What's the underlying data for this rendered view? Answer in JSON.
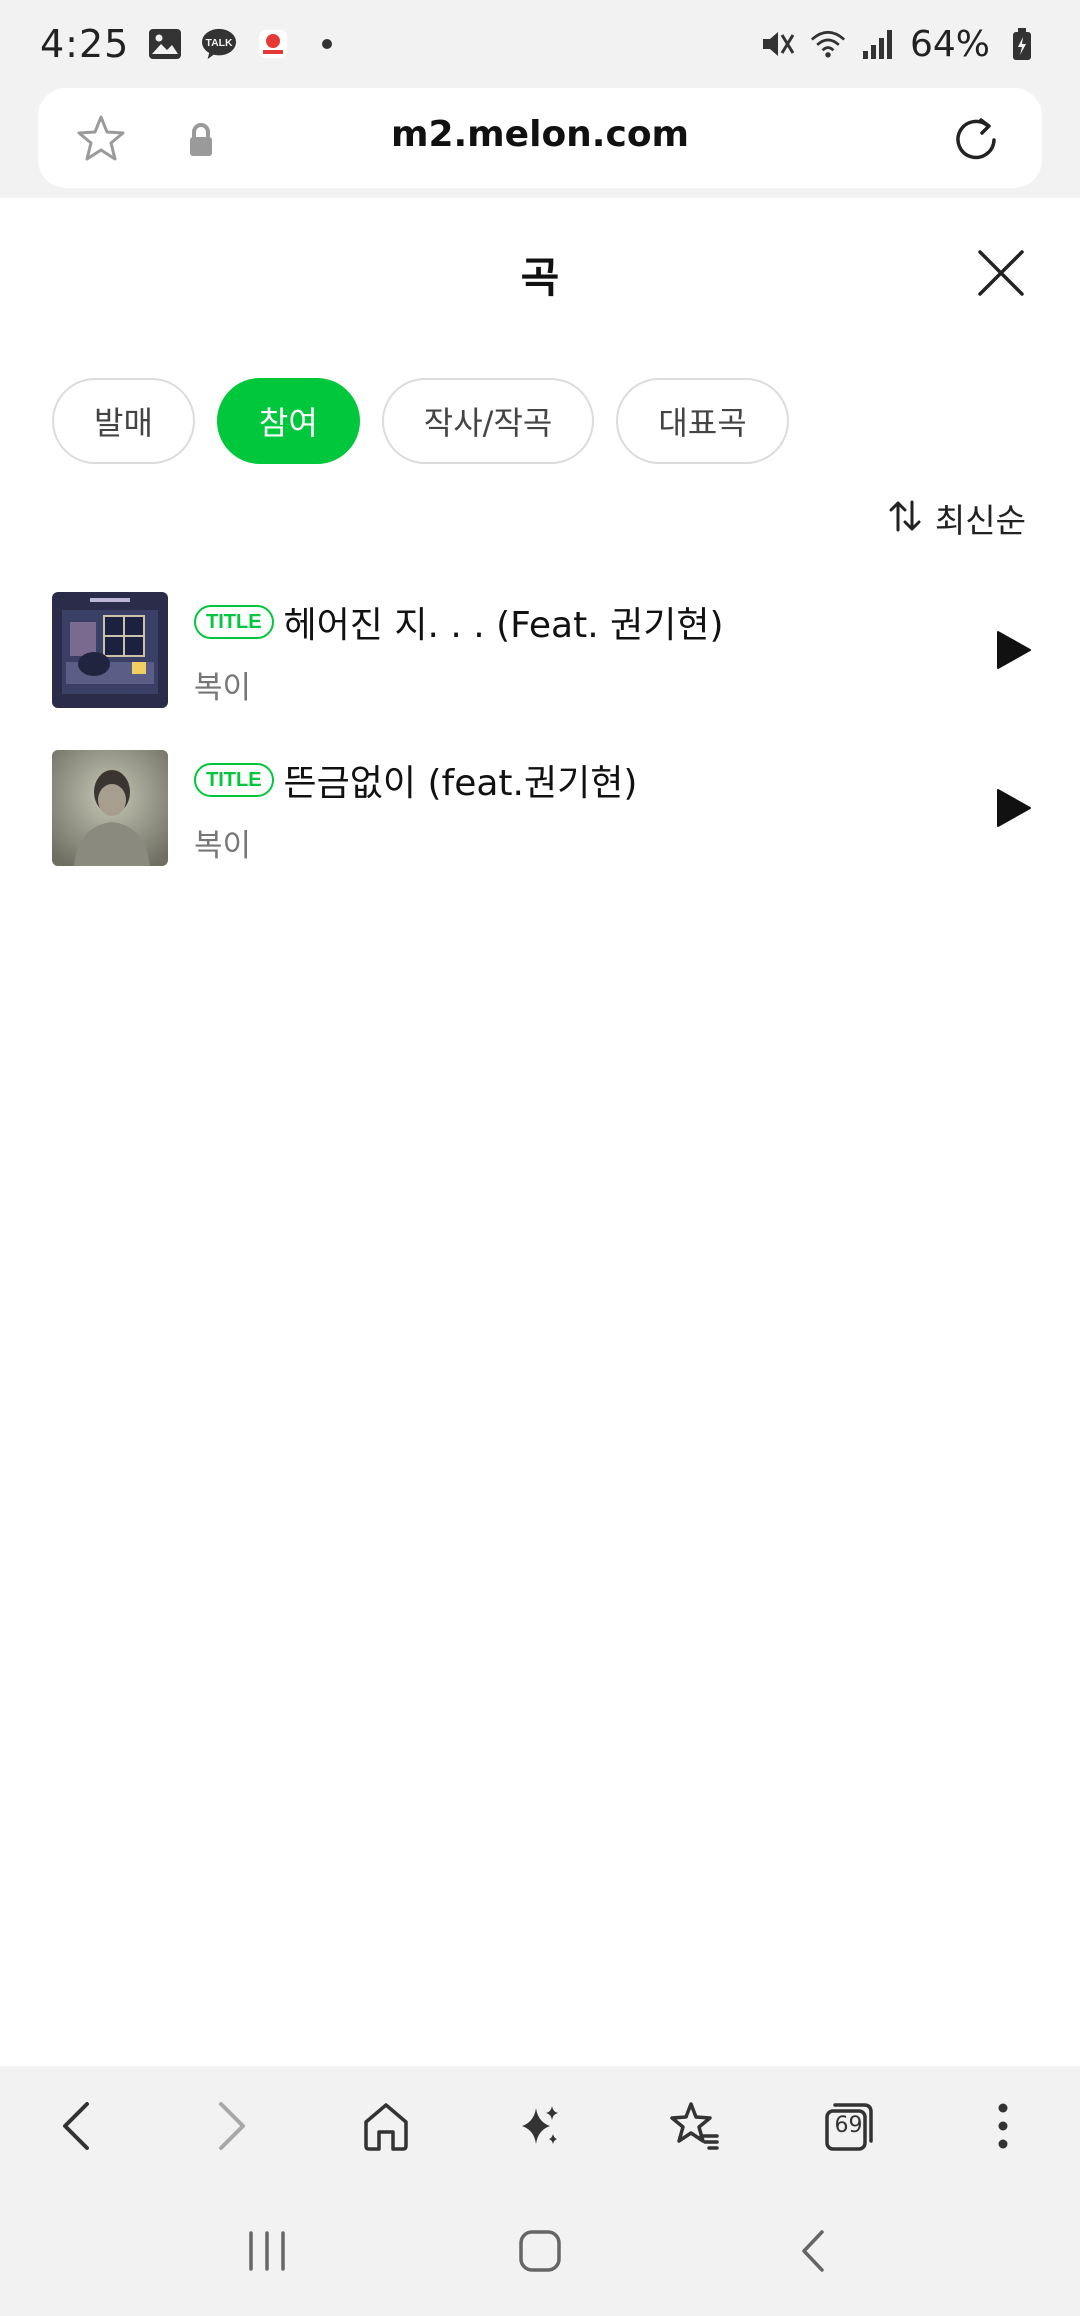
{
  "status_bar": {
    "time": "4:25",
    "battery": "64%",
    "icons": [
      "gallery-icon",
      "talk-icon",
      "app-notification-icon",
      "dot-icon",
      "mute-icon",
      "wifi-icon",
      "signal-icon",
      "battery-icon"
    ],
    "talk_label": "TALK"
  },
  "url_bar": {
    "url": "m2.melon.com"
  },
  "header": {
    "title": "곡"
  },
  "tabs": [
    {
      "label": "발매",
      "active": false
    },
    {
      "label": "참여",
      "active": true
    },
    {
      "label": "작사/작곡",
      "active": false
    },
    {
      "label": "대표곡",
      "active": false
    }
  ],
  "sort": {
    "label": "최신순"
  },
  "songs": [
    {
      "badge": "TITLE",
      "title": "헤어진 지. . . (Feat. 권기현)",
      "artist": "복이"
    },
    {
      "badge": "TITLE",
      "title": "뜬금없이 (feat.권기현)",
      "artist": "복이"
    }
  ],
  "toolbar": {
    "tab_count": "69",
    "items": [
      "back-icon",
      "forward-icon",
      "home-icon",
      "ai-sparkle-icon",
      "bookmarks-icon",
      "tabs-icon",
      "more-icon"
    ]
  },
  "colors": {
    "accent": "#00c73c",
    "background": "#ffffff",
    "chrome": "#f2f2f2"
  }
}
